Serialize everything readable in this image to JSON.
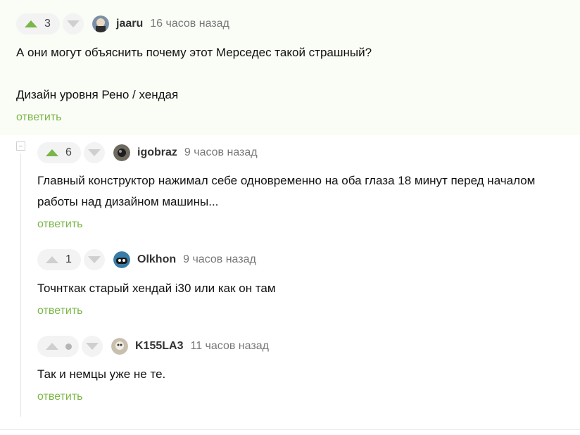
{
  "comments": [
    {
      "score": "3",
      "username": "jaaru",
      "time": "16 часов назад",
      "text_lines": [
        "А они могут объяснить почему этот Мерседес такой страшный?",
        "Дизайн уровня Рено / хендая"
      ],
      "reply_label": "ответить",
      "vote_state": "up"
    },
    {
      "score": "6",
      "username": "igobraz",
      "time": "9 часов назад",
      "text_lines": [
        "Главный конструктор нажимал себе одновременно на оба глаза 18 минут перед началом",
        "работы над дизайном машины..."
      ],
      "reply_label": "ответить",
      "vote_state": "up"
    },
    {
      "score": "1",
      "username": "Olkhon",
      "time": "9 часов назад",
      "text_lines": [
        "Точнткак старый хендай i30 или как он там"
      ],
      "reply_label": "ответить",
      "vote_state": "none"
    },
    {
      "score": "",
      "username": "K155LA3",
      "time": "11 часов назад",
      "text_lines": [
        "Так и немцы уже не те."
      ],
      "reply_label": "ответить",
      "vote_state": "none"
    }
  ],
  "colors": {
    "accent": "#7ab648",
    "muted": "#777777",
    "highlight_bg": "#fafcf6"
  }
}
